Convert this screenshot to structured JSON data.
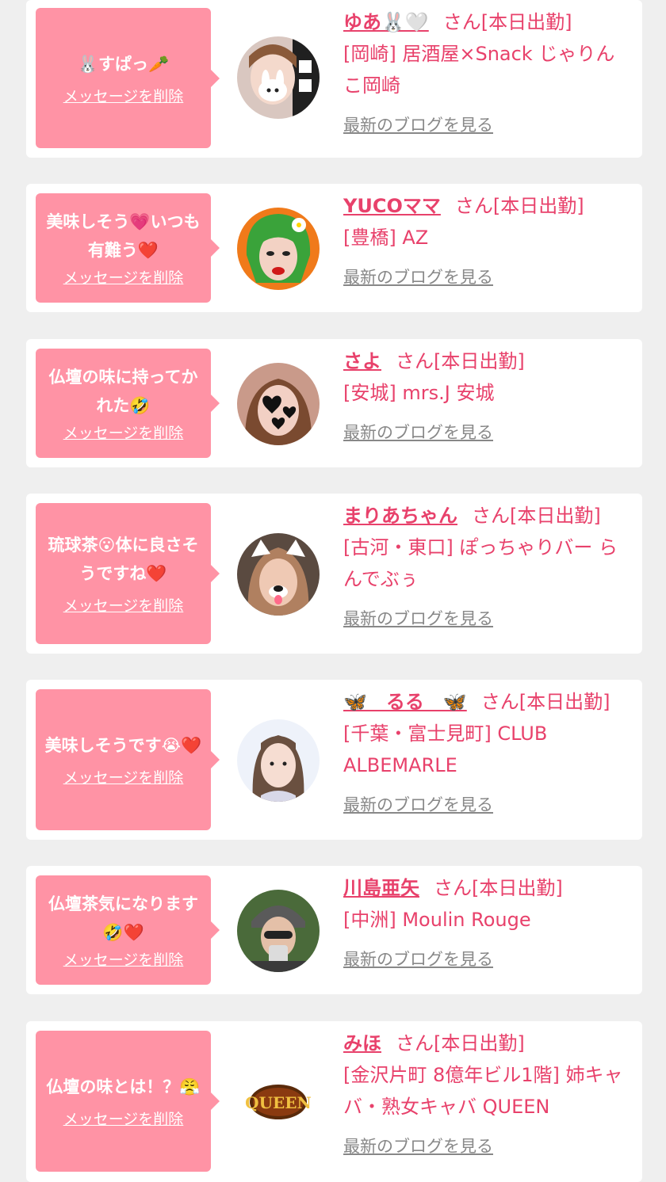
{
  "colors": {
    "background": "#efefef",
    "card": "#ffffff",
    "bubble": "#ff93a5",
    "accent": "#e8416b",
    "muted": "#888888"
  },
  "common": {
    "delete_label": "メッセージを削除",
    "blog_label": "最新のブログを見る",
    "suffix": "さん[本日出勤]"
  },
  "entries": [
    {
      "message": "🐰すぱっ🥕",
      "name": "ゆあ🐰🤍",
      "shop": "[岡崎] 居酒屋×Snack じゃりんこ岡崎",
      "avatar_icon": "avatar-photo"
    },
    {
      "message": "美味しそう💗いつも有難う❤️",
      "name": "YUCOママ",
      "shop": "[豊橋] AZ",
      "avatar_icon": "avatar-illustration"
    },
    {
      "message": "仏壇の味に持ってかれた🤣",
      "name": "さよ",
      "shop": "[安城] mrs.J 安城",
      "avatar_icon": "avatar-photo"
    },
    {
      "message": "琉球茶😮体に良さそうですね❤️",
      "name": "まりあちゃん",
      "shop": "[古河・東口] ぽっちゃりバー らんでぶぅ",
      "avatar_icon": "avatar-photo"
    },
    {
      "message": "美味しそうです😭❤️",
      "name": "🦋　るる　🦋",
      "shop": "[千葉・富士見町] CLUB ALBEMARLE",
      "avatar_icon": "avatar-photo"
    },
    {
      "message": "仏壇茶気になります🤣❤️",
      "name": "川島亜矢",
      "shop": "[中洲] Moulin Rouge",
      "avatar_icon": "avatar-photo"
    },
    {
      "message": "仏壇の味とは！？😤",
      "name": "みほ",
      "shop": "[金沢片町 8億年ビル1階] 姉キャバ・熟女キャバ QUEEN",
      "avatar_icon": "avatar-logo",
      "logo_text": "QUEEN"
    }
  ]
}
